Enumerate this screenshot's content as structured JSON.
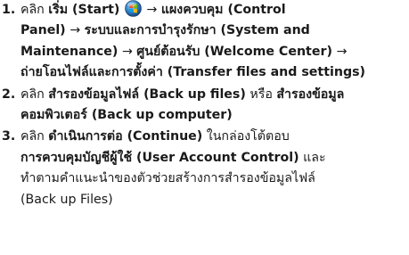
{
  "steps": [
    {
      "number": "1.",
      "line1": {
        "click": "คลิก",
        "start": "เริ่ม (Start)",
        "arrow1": "→",
        "control_panel": "แผงควบคุม (Control"
      },
      "line2": {
        "control_panel_end": "Panel)",
        "arrow2": "→",
        "system": "ระบบและการบำรุงรักษา (System and"
      },
      "line3": {
        "maintenance": "Maintenance)",
        "arrow3": "→",
        "welcome": "ศูนย์ต้อนรับ (Welcome Center)",
        "arrow4": "→"
      },
      "line4": {
        "transfer": "ถ่ายโอนไฟล์และการตั้งค่า (Transfer files and settings)"
      }
    },
    {
      "number": "2.",
      "line1": {
        "click": "คลิก",
        "backup_files": "สำรองข้อมูลไฟล์ (Back up files)",
        "or": "หรือ",
        "backup_computer_a": "สำรองข้อมูล"
      },
      "line2": {
        "backup_computer_b": "คอมพิวเตอร์ (Back up computer)"
      }
    },
    {
      "number": "3.",
      "line1": {
        "click": "คลิก",
        "continue": "ดำเนินการต่อ (Continue)",
        "in_dialog": "ในกล่องโต้ตอบ"
      },
      "line2": {
        "uac": "การควบคุมบัญชีผู้ใช้ (User Account Control)",
        "and": "และ"
      },
      "line3": {
        "follow": "ทำตามคำแนะนำของตัวช่วยสร้างการสำรองข้อมูลไฟล์"
      },
      "line4": {
        "backup_files_en": "(Back up Files)"
      }
    }
  ],
  "icons": {
    "start_orb": "windows-start-orb-icon"
  }
}
